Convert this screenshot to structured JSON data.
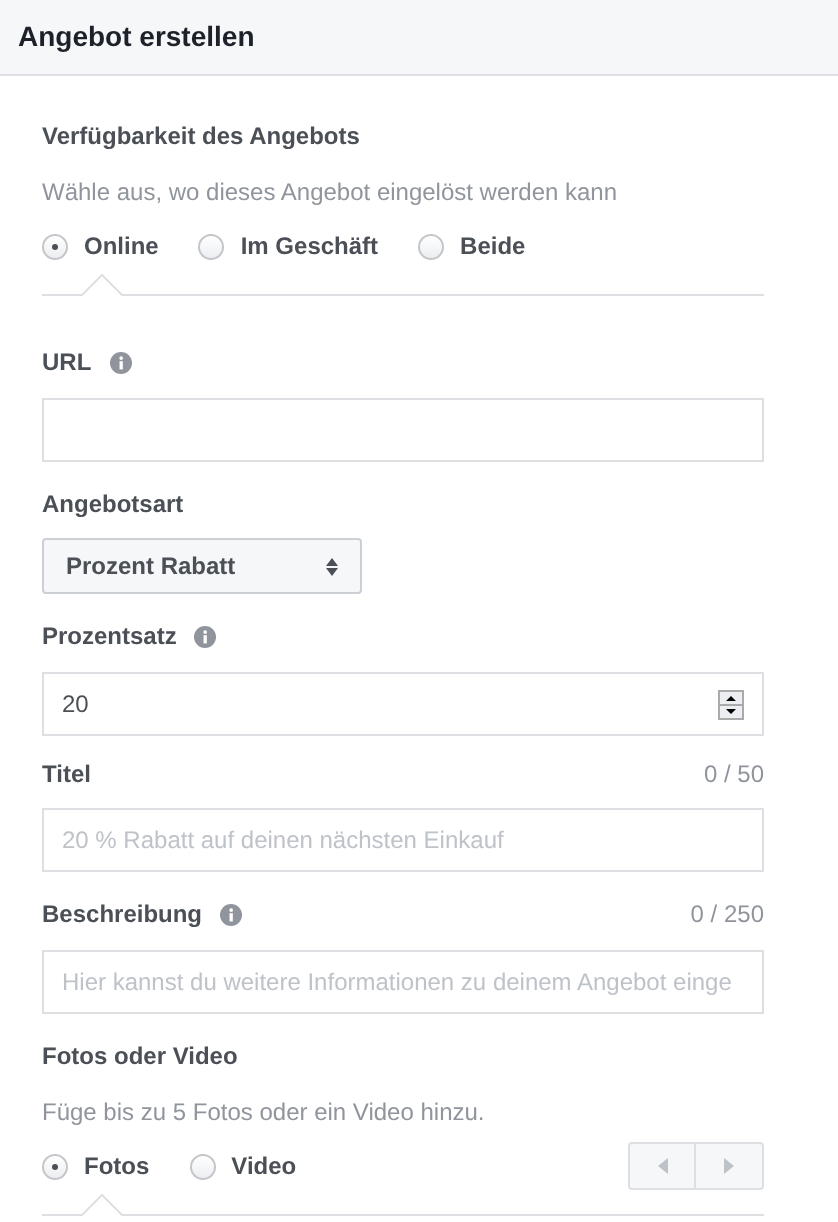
{
  "header": {
    "title": "Angebot erstellen"
  },
  "availability": {
    "label": "Verfügbarkeit des Angebots",
    "hint": "Wähle aus, wo dieses Angebot eingelöst werden kann",
    "options": [
      {
        "label": "Online",
        "selected": true
      },
      {
        "label": "Im Geschäft",
        "selected": false
      },
      {
        "label": "Beide",
        "selected": false
      }
    ]
  },
  "url": {
    "label": "URL"
  },
  "offer_type": {
    "label": "Angebotsart",
    "value": "Prozent Rabatt"
  },
  "percentage": {
    "label": "Prozentsatz",
    "value": "20"
  },
  "title": {
    "label": "Titel",
    "counter": "0 / 50",
    "placeholder": "20 % Rabatt auf deinen nächsten Einkauf"
  },
  "description": {
    "label": "Beschreibung",
    "counter": "0 / 250",
    "placeholder": "Hier kannst du weitere Informationen zu deinem Angebot einge"
  },
  "media": {
    "label": "Fotos oder Video",
    "hint": "Füge bis zu 5 Fotos oder ein Video hinzu.",
    "options": [
      {
        "label": "Fotos",
        "selected": true
      },
      {
        "label": "Video",
        "selected": false
      }
    ]
  }
}
